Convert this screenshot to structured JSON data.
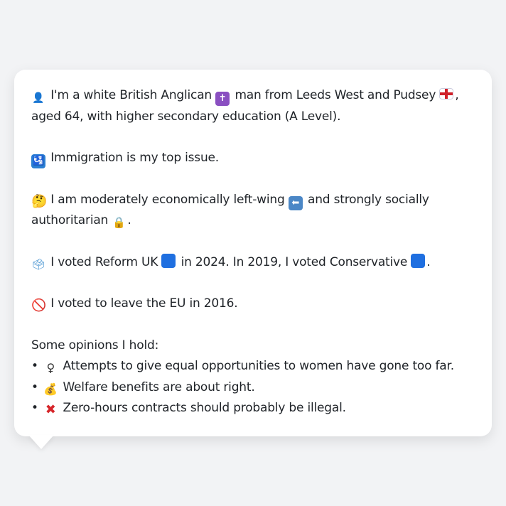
{
  "profile": {
    "line1_pre": "I'm a white British Anglican",
    "line1_mid": "man from Leeds West and Pudsey",
    "line1_post": ",",
    "line1_cont": "aged 64, with higher secondary education (A Level).",
    "issue": "Immigration is my top issue.",
    "ideology_pre": "I am moderately economically left-wing",
    "ideology_mid": "and strongly socially",
    "ideology_cont": "authoritarian",
    "ideology_post": ".",
    "vote_pre": "I voted Reform UK",
    "vote_mid": "in 2024. In 2019, I voted Conservative",
    "vote_post": ".",
    "brexit": "I voted to leave the EU in 2016.",
    "opinions_heading": "Some opinions I hold:",
    "opinions": [
      "Attempts to give equal opportunities to women have gone too far.",
      "Welfare benefits are about right.",
      "Zero-hours contracts should probably be illegal."
    ]
  },
  "icons": {
    "person": "👤",
    "cross": "✝",
    "imm": "🛂",
    "think": "🤔",
    "arrow": "⬅",
    "lock": "🔒",
    "box": "🗳",
    "ban": "🚫",
    "fem": "♀",
    "bag": "💰",
    "x": "✖",
    "bullet": "•"
  },
  "colors": {
    "background": "#f2f3f5",
    "card": "#ffffff",
    "text": "#1f2328",
    "reform": "#1f6fe0",
    "conservative": "#1f6fe0"
  }
}
